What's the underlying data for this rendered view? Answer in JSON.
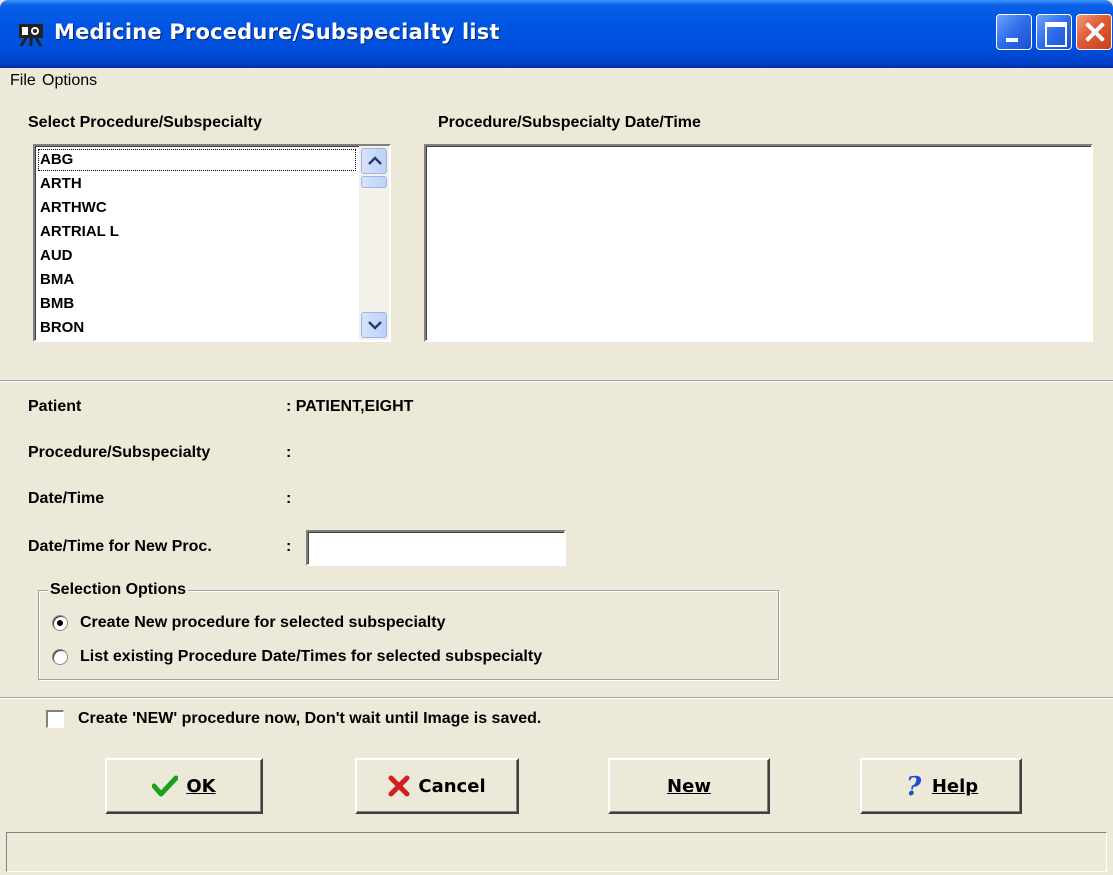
{
  "window": {
    "title": "Medicine Procedure/Subspecialty list"
  },
  "menu": {
    "file": "File",
    "options": "Options"
  },
  "labels": {
    "select_header": "Select Procedure/Subspecialty",
    "datetime_header": "Procedure/Subspecialty Date/Time"
  },
  "procedures": {
    "items": [
      "ABG",
      "ARTH",
      "ARTHWC",
      "ARTRIAL L",
      "AUD",
      "BMA",
      "BMB",
      "BRON"
    ],
    "selected": "ABG"
  },
  "info": {
    "patient_label": "Patient",
    "patient_colon": ": PATIENT,EIGHT",
    "procsub_label": "Procedure/Subspecialty",
    "procsub_colon": ":",
    "datetime_label": "Date/Time",
    "datetime_colon": ":",
    "newproc_label": "Date/Time for New Proc.",
    "newproc_colon": ":",
    "newproc_value": ""
  },
  "selection_options": {
    "legend": "Selection Options",
    "option_create": "Create New procedure for selected subspecialty",
    "option_list": "List existing Procedure Date/Times for selected subspecialty",
    "selected": "create"
  },
  "create_now": {
    "label": "Create 'NEW' procedure now, Don't wait until Image is saved.",
    "checked": false
  },
  "buttons": {
    "ok": "OK",
    "cancel": "Cancel",
    "new": "New",
    "help": "Help"
  },
  "status": {
    "text": ""
  }
}
